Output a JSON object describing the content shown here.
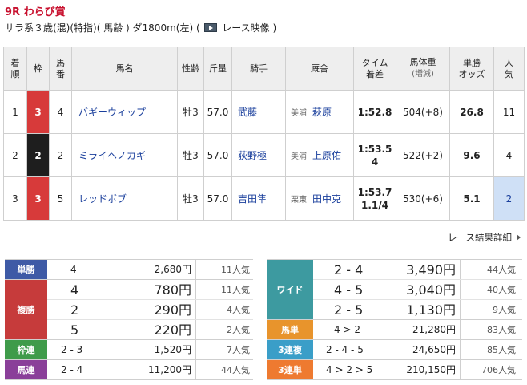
{
  "race": {
    "title": "9R わらび賞",
    "conditions_before": "サラ系３歳(混)(特指)( 馬齢 ) ダ1800m(左)  (",
    "video_label": "レース映像",
    "conditions_after": ")"
  },
  "table": {
    "headers": {
      "rank": [
        "着",
        "順"
      ],
      "waku": "枠",
      "umaban": [
        "馬",
        "番"
      ],
      "horse": "馬名",
      "sexage": "性齢",
      "weight": "斤量",
      "jockey": "騎手",
      "trainer": "厩舎",
      "time": [
        "タイム",
        "着差"
      ],
      "body": [
        "馬体重",
        "(増減)"
      ],
      "odds": [
        "単勝",
        "オッズ"
      ],
      "popularity": [
        "人",
        "気"
      ]
    },
    "rows": [
      {
        "rank": "1",
        "waku": "3",
        "umaban": "4",
        "horse": "バギーウィップ",
        "sexage": "牡3",
        "weight": "57.0",
        "jockey": "武藤",
        "trainer_area": "美浦",
        "trainer": "萩原",
        "time": "1:52.8",
        "margin": "",
        "body": "504(+8)",
        "odds": "26.8",
        "popularity": "11"
      },
      {
        "rank": "2",
        "waku": "2",
        "umaban": "2",
        "horse": "ミライヘノカギ",
        "sexage": "牡3",
        "weight": "57.0",
        "jockey": "荻野極",
        "trainer_area": "美浦",
        "trainer": "上原佑",
        "time": "1:53.5",
        "margin": "4",
        "body": "522(+2)",
        "odds": "9.6",
        "popularity": "4"
      },
      {
        "rank": "3",
        "waku": "3",
        "umaban": "5",
        "horse": "レッドボブ",
        "sexage": "牡3",
        "weight": "57.0",
        "jockey": "吉田隼",
        "trainer_area": "栗東",
        "trainer": "田中克",
        "time": "1:53.7",
        "margin": "1.1/4",
        "body": "530(+6)",
        "odds": "5.1",
        "popularity": "2"
      }
    ]
  },
  "detail_link": "レース結果詳細",
  "payout_left": {
    "tansho": {
      "label": "単勝",
      "combo": "4",
      "yen": "2,680円",
      "pop": "11人気"
    },
    "fukusho": {
      "label": "複勝",
      "rows": [
        {
          "combo": "4",
          "yen": "780円",
          "pop": "11人気"
        },
        {
          "combo": "2",
          "yen": "290円",
          "pop": "4人気"
        },
        {
          "combo": "5",
          "yen": "220円",
          "pop": "2人気"
        }
      ]
    },
    "wakuren": {
      "label": "枠連",
      "combo": "2 - 3",
      "yen": "1,520円",
      "pop": "7人気"
    },
    "umaren": {
      "label": "馬連",
      "combo": "2 - 4",
      "yen": "11,200円",
      "pop": "44人気"
    }
  },
  "payout_right": {
    "wide": {
      "label": "ワイド",
      "rows": [
        {
          "combo": "2 - 4",
          "yen": "3,490円",
          "pop": "44人気"
        },
        {
          "combo": "4 - 5",
          "yen": "3,040円",
          "pop": "40人気"
        },
        {
          "combo": "2 - 5",
          "yen": "1,130円",
          "pop": "9人気"
        }
      ]
    },
    "umatan": {
      "label": "馬単",
      "combo": "4 > 2",
      "yen": "21,280円",
      "pop": "83人気"
    },
    "sanrenpuku": {
      "label": "3連複",
      "combo": "2 - 4 - 5",
      "yen": "24,650円",
      "pop": "85人気"
    },
    "sanrentan": {
      "label": "3連単",
      "combo": "4 > 2 > 5",
      "yen": "210,150円",
      "pop": "706人気"
    }
  },
  "colors": {
    "title_red": "#c8102e",
    "link_blue": "#1a3f9c",
    "waku_red": "#d73a3a",
    "waku_black": "#1e1e1e"
  }
}
